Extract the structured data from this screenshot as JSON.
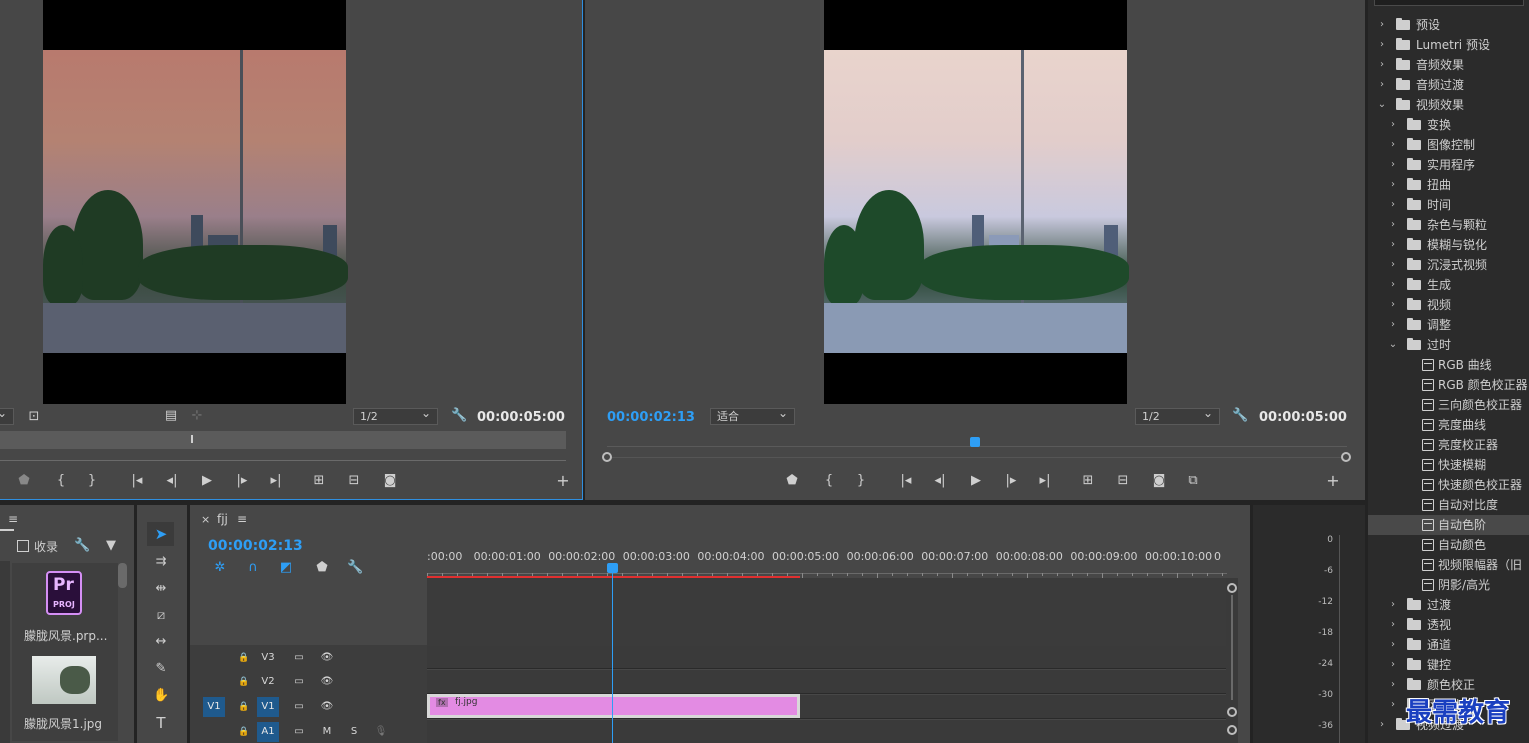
{
  "source_monitor": {
    "zoom": "1/2",
    "duration": "00:00:05:00"
  },
  "program_monitor": {
    "timecode": "00:00:02:13",
    "fit": "适合",
    "zoom": "1/2",
    "duration": "00:00:05:00"
  },
  "project": {
    "checkbox_label": "收录",
    "items": [
      {
        "name": "朦胧风景.prp...",
        "badge_top": "Pr",
        "badge_bottom": "PROJ"
      },
      {
        "name": "朦胧风景1.jpg"
      }
    ]
  },
  "timeline": {
    "tab": "fjj",
    "close_glyph": "×",
    "menu_glyph": "≡",
    "timecode": "00:00:02:13",
    "ruler": [
      ":00:00",
      "00:00:01:00",
      "00:00:02:00",
      "00:00:03:00",
      "00:00:04:00",
      "00:00:05:00",
      "00:00:06:00",
      "00:00:07:00",
      "00:00:08:00",
      "00:00:09:00",
      "00:00:10:00",
      "0"
    ],
    "playhead_fraction": 0.2325,
    "tracks": [
      {
        "id": "V3",
        "patch": ""
      },
      {
        "id": "V2",
        "patch": ""
      },
      {
        "id": "V1",
        "patch": "V1"
      },
      {
        "id": "A1",
        "patch": "",
        "m": "M",
        "s": "S"
      }
    ],
    "clip": {
      "name": "fj.jpg",
      "fx": "fx",
      "color": "#e38be3"
    }
  },
  "meter": {
    "labels": [
      "0",
      "-6",
      "-12",
      "-18",
      "-24",
      "-30",
      "-36"
    ]
  },
  "effects": {
    "items": [
      {
        "label": "预设",
        "level": 0,
        "type": "folder",
        "open": false
      },
      {
        "label": "Lumetri 预设",
        "level": 0,
        "type": "folder",
        "open": false
      },
      {
        "label": "音频效果",
        "level": 0,
        "type": "folder",
        "open": false
      },
      {
        "label": "音频过渡",
        "level": 0,
        "type": "folder",
        "open": false
      },
      {
        "label": "视频效果",
        "level": 0,
        "type": "folder",
        "open": true
      },
      {
        "label": "变换",
        "level": 1,
        "type": "folder",
        "open": false
      },
      {
        "label": "图像控制",
        "level": 1,
        "type": "folder",
        "open": false
      },
      {
        "label": "实用程序",
        "level": 1,
        "type": "folder",
        "open": false
      },
      {
        "label": "扭曲",
        "level": 1,
        "type": "folder",
        "open": false
      },
      {
        "label": "时间",
        "level": 1,
        "type": "folder",
        "open": false
      },
      {
        "label": "杂色与颗粒",
        "level": 1,
        "type": "folder",
        "open": false
      },
      {
        "label": "模糊与锐化",
        "level": 1,
        "type": "folder",
        "open": false
      },
      {
        "label": "沉浸式视频",
        "level": 1,
        "type": "folder",
        "open": false
      },
      {
        "label": "生成",
        "level": 1,
        "type": "folder",
        "open": false
      },
      {
        "label": "视频",
        "level": 1,
        "type": "folder",
        "open": false
      },
      {
        "label": "调整",
        "level": 1,
        "type": "folder",
        "open": false
      },
      {
        "label": "过时",
        "level": 1,
        "type": "folder",
        "open": true
      },
      {
        "label": "RGB 曲线",
        "level": 2,
        "type": "effect"
      },
      {
        "label": "RGB 颜色校正器",
        "level": 2,
        "type": "effect"
      },
      {
        "label": "三向颜色校正器",
        "level": 2,
        "type": "effect"
      },
      {
        "label": "亮度曲线",
        "level": 2,
        "type": "effect"
      },
      {
        "label": "亮度校正器",
        "level": 2,
        "type": "effect"
      },
      {
        "label": "快速模糊",
        "level": 2,
        "type": "effect"
      },
      {
        "label": "快速颜色校正器",
        "level": 2,
        "type": "effect"
      },
      {
        "label": "自动对比度",
        "level": 2,
        "type": "effect"
      },
      {
        "label": "自动色阶",
        "level": 2,
        "type": "effect",
        "selected": true
      },
      {
        "label": "自动颜色",
        "level": 2,
        "type": "effect"
      },
      {
        "label": "视频限幅器（旧",
        "level": 2,
        "type": "effect"
      },
      {
        "label": "阴影/高光",
        "level": 2,
        "type": "effect"
      },
      {
        "label": "过渡",
        "level": 1,
        "type": "folder",
        "open": false
      },
      {
        "label": "透视",
        "level": 1,
        "type": "folder",
        "open": false
      },
      {
        "label": "通道",
        "level": 1,
        "type": "folder",
        "open": false
      },
      {
        "label": "键控",
        "level": 1,
        "type": "folder",
        "open": false
      },
      {
        "label": "颜色校正",
        "level": 1,
        "type": "folder",
        "open": false
      },
      {
        "label": "风格化",
        "level": 1,
        "type": "folder",
        "open": false
      },
      {
        "label": "视频过渡",
        "level": 0,
        "type": "folder",
        "open": false
      }
    ]
  },
  "watermark": "最需教育",
  "colors": {
    "accent": "#2e9ef5",
    "clip": "#e38be3",
    "work_area": "#e03030"
  }
}
